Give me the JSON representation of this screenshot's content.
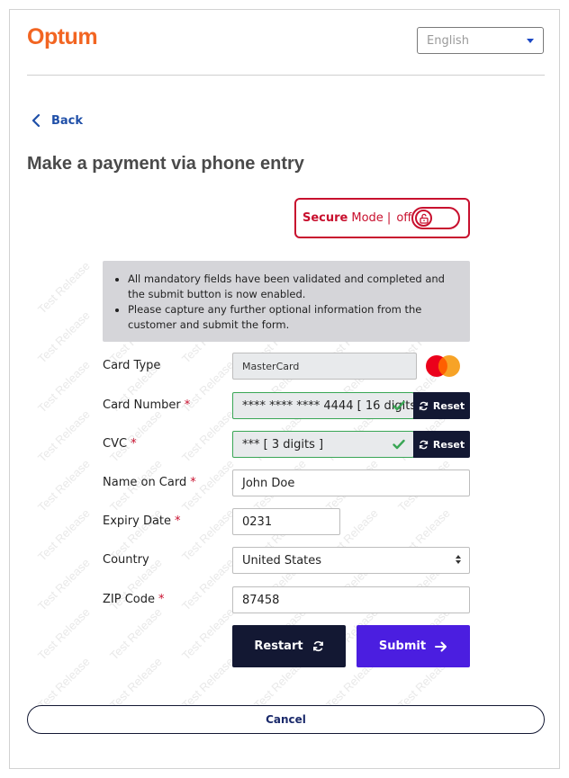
{
  "header": {
    "logo_text": "Optum",
    "language_selected": "English"
  },
  "nav": {
    "back_label": "Back"
  },
  "page": {
    "title": "Make a payment via phone entry"
  },
  "secure_mode": {
    "strong_label": "Secure",
    "mode_label": "Mode |",
    "state_label": "off",
    "enabled": false
  },
  "info": {
    "items": [
      "All mandatory fields have been validated and completed and the submit button is now enabled.",
      "Please capture any further optional information from the customer and submit the form."
    ]
  },
  "form": {
    "card_type": {
      "label": "Card Type",
      "value": "MasterCard"
    },
    "card_number": {
      "label": "Card Number",
      "value": "**** **** **** 4444 [ 16 digits ]",
      "reset_label": "Reset"
    },
    "cvc": {
      "label": "CVC",
      "value": "*** [ 3 digits ]",
      "reset_label": "Reset"
    },
    "name_on_card": {
      "label": "Name on Card",
      "value": "John Doe"
    },
    "expiry_date": {
      "label": "Expiry Date",
      "value": "0231"
    },
    "country": {
      "label": "Country",
      "value": "United States"
    },
    "zip_code": {
      "label": "ZIP Code",
      "value": "87458"
    },
    "required_marker": "*"
  },
  "actions": {
    "restart_label": "Restart",
    "submit_label": "Submit",
    "cancel_label": "Cancel"
  },
  "watermark_text": "Test Release",
  "colors": {
    "brand_orange": "#f26522",
    "secure_red": "#c8102e",
    "dark_navy": "#131833",
    "submit_purple": "#4b1ee0",
    "valid_green": "#3aa655",
    "link_blue": "#1f4fa8"
  }
}
